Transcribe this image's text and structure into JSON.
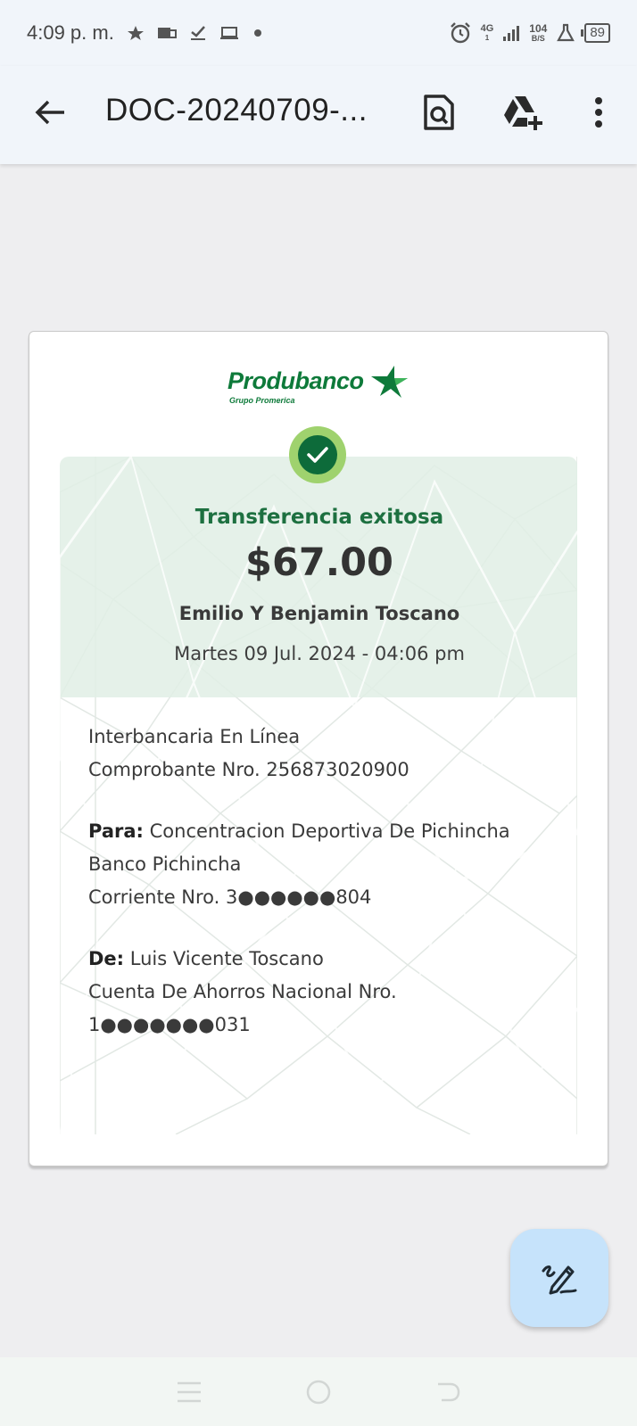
{
  "status_bar": {
    "time": "4:09 p. m.",
    "network": "4G",
    "network_sub": "1",
    "speed_value": "104",
    "speed_unit": "B/S",
    "battery": "89",
    "icons": [
      "star-icon",
      "mail-icon",
      "check-icon",
      "laptop-icon",
      "dot-icon",
      "alarm-icon",
      "signal-icon",
      "flask-icon",
      "battery-icon"
    ]
  },
  "app_bar": {
    "title": "DOC-20240709-...",
    "icons": [
      "back-arrow-icon",
      "search-document-icon",
      "drive-add-icon",
      "more-vert-icon"
    ]
  },
  "receipt": {
    "logo_name": "Produbanco",
    "logo_sub": "Grupo Promerica",
    "status": "Transferencia exitosa",
    "amount": "$67.00",
    "beneficiary": "Emilio Y Benjamin Toscano",
    "datetime": "Martes 09 Jul. 2024 - 04:06 pm",
    "type": "Interbancaria En Línea",
    "voucher": "Comprobante Nro. 256873020900",
    "to_label": "Para:",
    "to_name": "Concentracion Deportiva De Pichincha",
    "to_bank": "Banco Pichincha",
    "to_account": "Corriente Nro. 3●●●●●●804",
    "from_label": "De:",
    "from_name": "Luis Vicente Toscano",
    "from_account_type": "Cuenta De Ahorros Nacional Nro.",
    "from_account": "1●●●●●●●031",
    "colors": {
      "brand_green": "#0e7a3a",
      "check_green": "#0d6b3a",
      "check_ring": "#9fd26e",
      "hero_bg": "#e1eee5"
    }
  },
  "fab": {
    "icon": "edit-pen-icon"
  },
  "nav_bar": {
    "icons": [
      "menu-icon",
      "home-icon",
      "back-icon"
    ]
  }
}
